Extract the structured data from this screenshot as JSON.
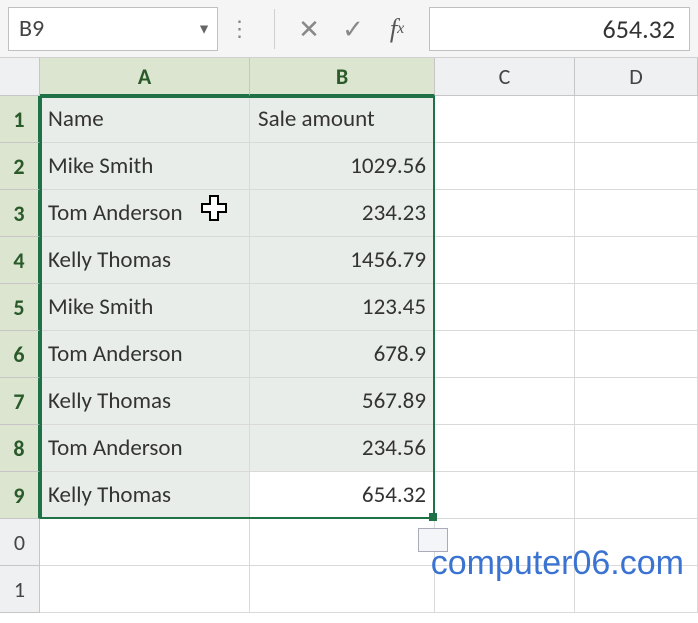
{
  "formula_bar": {
    "name_box": "B9",
    "formula_value": "654.32"
  },
  "columns": [
    "A",
    "B",
    "C",
    "D"
  ],
  "row_numbers": [
    "1",
    "2",
    "3",
    "4",
    "5",
    "6",
    "7",
    "8",
    "9",
    "0",
    "1"
  ],
  "header_row": {
    "nameCol": "Name",
    "amountCol": "Sale amount"
  },
  "data_rows": [
    {
      "name": "Mike Smith",
      "amount": "1029.56"
    },
    {
      "name": "Tom Anderson",
      "amount": "234.23"
    },
    {
      "name": "Kelly Thomas",
      "amount": "1456.79"
    },
    {
      "name": "Mike Smith",
      "amount": "123.45"
    },
    {
      "name": "Tom Anderson",
      "amount": "678.9"
    },
    {
      "name": "Kelly Thomas",
      "amount": "567.89"
    },
    {
      "name": "Tom Anderson",
      "amount": "234.56"
    },
    {
      "name": "Kelly Thomas",
      "amount": "654.32"
    }
  ],
  "watermark": "computer06.com",
  "chart_data": {
    "type": "table",
    "title": "",
    "columns": [
      "Name",
      "Sale amount"
    ],
    "rows": [
      [
        "Mike Smith",
        1029.56
      ],
      [
        "Tom Anderson",
        234.23
      ],
      [
        "Kelly Thomas",
        1456.79
      ],
      [
        "Mike Smith",
        123.45
      ],
      [
        "Tom Anderson",
        678.9
      ],
      [
        "Kelly Thomas",
        567.89
      ],
      [
        "Tom Anderson",
        234.56
      ],
      [
        "Kelly Thomas",
        654.32
      ]
    ]
  }
}
